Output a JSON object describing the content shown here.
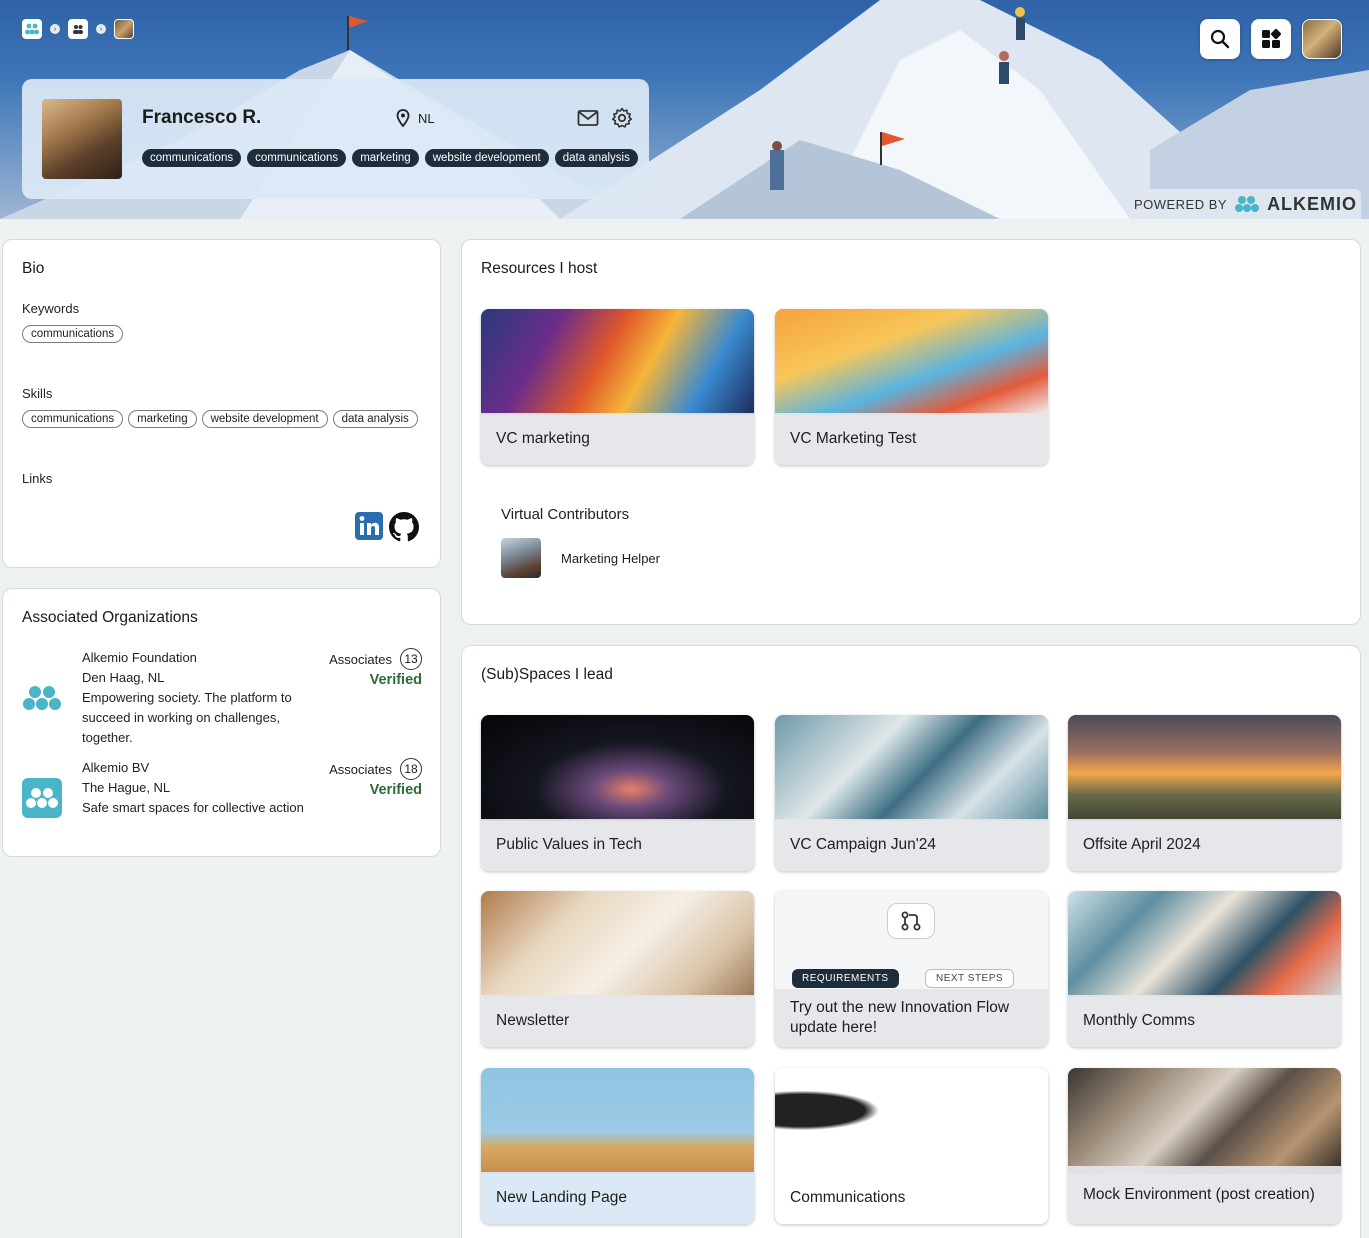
{
  "profile": {
    "name": "Francesco R.",
    "country": "NL",
    "tags": [
      "communications",
      "communications",
      "marketing",
      "website development",
      "data analysis"
    ]
  },
  "banner": {
    "powered_by": "POWERED BY",
    "brand": "ALKEMIO"
  },
  "bio": {
    "title": "Bio",
    "keywords_label": "Keywords",
    "keywords": [
      "communications"
    ],
    "skills_label": "Skills",
    "skills": [
      "communications",
      "marketing",
      "website development",
      "data analysis"
    ],
    "links_label": "Links"
  },
  "organizations": {
    "title": "Associated Organizations",
    "items": [
      {
        "name": "Alkemio Foundation",
        "location": "Den Haag, NL",
        "description": "Empowering society. The platform to succeed in working on challenges, together.",
        "associates_label": "Associates",
        "associates": "13",
        "verified": "Verified"
      },
      {
        "name": "Alkemio BV",
        "location": "The Hague, NL",
        "description": "Safe smart spaces for collective action",
        "associates_label": "Associates",
        "associates": "18",
        "verified": "Verified"
      }
    ]
  },
  "resources": {
    "title": "Resources I host",
    "cards": [
      "VC marketing",
      "VC Marketing Test"
    ],
    "vc_title": "Virtual Contributors",
    "vc_name": "Marketing Helper"
  },
  "subspaces": {
    "title": "(Sub)Spaces I lead",
    "cards": [
      "Public Values in Tech",
      "VC Campaign Jun'24",
      "Offsite April 2024",
      "Newsletter",
      "Try out the new Innovation Flow update here!",
      "Monthly Comms",
      "New Landing Page",
      "Communications",
      "Mock Environment (post creation)"
    ],
    "innovation_flow": {
      "step1": "REQUIREMENTS",
      "step2": "NEXT STEPS"
    }
  },
  "colors": {
    "accent": "#48b5c8",
    "dark_tag": "#1e2d3c",
    "verified": "#2e6b3a",
    "page_bg": "#edf1f2"
  }
}
